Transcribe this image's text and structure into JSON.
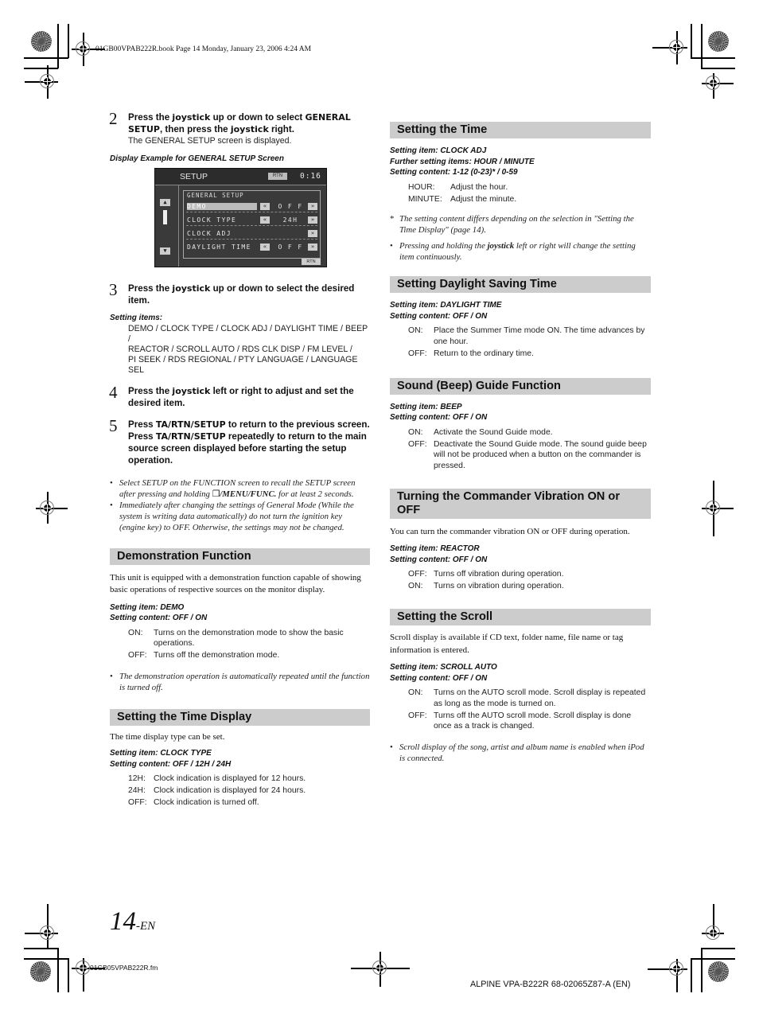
{
  "slug_top": "01GB00VPAB222R.book  Page 14  Monday, January 23, 2006  4:24 AM",
  "slug_bottom": "01GB05VPAB222R.fm",
  "footer": "ALPINE VPA-B222R 68-02065Z87-A (EN)",
  "page_number": {
    "number": "14",
    "suffix": "-EN"
  },
  "left": {
    "step2": {
      "num": "2",
      "text_parts": [
        "Press the ",
        "joystick",
        " up or down to select ",
        "GENERAL SETUP",
        ", then press the ",
        "joystick",
        " right."
      ],
      "sub": "The GENERAL SETUP screen is displayed."
    },
    "display_caption": "Display Example for GENERAL SETUP Screen",
    "screen": {
      "title": "SETUP",
      "rtn_top": "RTN",
      "clock": "0:16",
      "up_icon": "▲",
      "down_icon": "▼",
      "panel_title": "GENERAL SETUP",
      "rows": [
        {
          "label": "DEMO",
          "value": "O F F",
          "left_btn": "«",
          "right_btn": "»",
          "selected": true
        },
        {
          "label": "CLOCK TYPE",
          "value": "24H",
          "left_btn": "«",
          "right_btn": "»",
          "selected": false
        },
        {
          "label": "CLOCK ADJ",
          "value": "",
          "left_btn": "",
          "right_btn": "»",
          "selected": false
        },
        {
          "label": "DAYLIGHT TIME",
          "value": "O F F",
          "left_btn": "«",
          "right_btn": "»",
          "selected": false
        }
      ],
      "rtn_bottom": "RTN"
    },
    "step3": {
      "num": "3",
      "text_parts": [
        "Press the ",
        "joystick",
        " up or down to select the desired item."
      ]
    },
    "setting_items_label": "Setting items:",
    "setting_items_lines": [
      "DEMO / CLOCK TYPE / CLOCK ADJ / DAYLIGHT TIME / BEEP /",
      "REACTOR / SCROLL AUTO / RDS CLK DISP / FM LEVEL /",
      "PI SEEK / RDS REGIONAL / PTY LANGUAGE / LANGUAGE SEL"
    ],
    "step4": {
      "num": "4",
      "text_parts": [
        "Press the ",
        "joystick",
        " left or right to adjust and set the desired item."
      ]
    },
    "step5": {
      "num": "5",
      "text_parts": [
        "Press ",
        "TA/RTN/SETUP",
        " to return to the previous screen. Press ",
        "TA/RTN/SETUP",
        " repeatedly to return to the main source screen displayed before starting the setup operation."
      ]
    },
    "notes": [
      {
        "pre": "Select SETUP on the FUNCTION screen to recall the SETUP screen after pressing and holding ",
        "icon": "❐",
        "bold": "/MENU/FUNC.",
        "post": " for at least 2 seconds."
      },
      {
        "pre": "Immediately after changing the settings of General Mode (While the system is writing data automatically) do not turn the ignition key (engine key) to OFF. Otherwise, the settings may not be changed.",
        "icon": "",
        "bold": "",
        "post": ""
      }
    ],
    "demo": {
      "heading": "Demonstration Function",
      "intro": "This unit is equipped with a demonstration function capable of showing basic operations of respective sources on the monitor display.",
      "item": "Setting item: DEMO",
      "content": "Setting content: OFF / ON",
      "defs": [
        {
          "term": "ON:",
          "desc": "Turns on the demonstration mode to show the basic operations."
        },
        {
          "term": "OFF:",
          "desc": "Turns off the demonstration mode."
        }
      ],
      "note": "The demonstration operation is automatically repeated until the function is turned off."
    },
    "time_display": {
      "heading": "Setting the Time Display",
      "intro": "The time display type can be set.",
      "item": "Setting item: CLOCK TYPE",
      "content": "Setting content: OFF / 12H / 24H",
      "defs": [
        {
          "term": "12H:",
          "desc": "Clock indication is displayed for 12 hours."
        },
        {
          "term": "24H:",
          "desc": "Clock indication is displayed for 24 hours."
        },
        {
          "term": "OFF:",
          "desc": "Clock indication is turned off."
        }
      ]
    }
  },
  "right": {
    "time": {
      "heading": "Setting the Time",
      "item": "Setting item: CLOCK ADJ",
      "further": "Further setting items: HOUR / MINUTE",
      "content": "Setting content: 1-12 (0-23)* / 0-59",
      "defs": [
        {
          "term": "HOUR:",
          "desc": "Adjust the hour."
        },
        {
          "term": "MINUTE:",
          "desc": "Adjust the minute."
        }
      ],
      "footnote": "The setting content differs depending on the selection in \"Setting the Time Display\" (page 14).",
      "footnote_mark": "*",
      "note_pre": "Pressing and holding the ",
      "note_bold": "joystick",
      "note_post": " left or right will change the setting item continuously."
    },
    "daylight": {
      "heading": "Setting Daylight Saving Time",
      "item": "Setting item: DAYLIGHT TIME",
      "content": "Setting content: OFF / ON",
      "defs": [
        {
          "term": "ON:",
          "desc": "Place the Summer Time mode ON. The time advances by one hour."
        },
        {
          "term": "OFF:",
          "desc": "Return to the ordinary time."
        }
      ]
    },
    "beep": {
      "heading": "Sound (Beep) Guide Function",
      "item": "Setting item: BEEP",
      "content": "Setting content: OFF / ON",
      "defs": [
        {
          "term": "ON:",
          "desc": "Activate the Sound Guide mode."
        },
        {
          "term": "OFF:",
          "desc": "Deactivate the Sound Guide mode. The sound guide beep will not be produced when a button on the commander is pressed."
        }
      ]
    },
    "vibration": {
      "heading": "Turning the Commander Vibration ON or OFF",
      "intro": "You can turn the commander vibration ON or OFF during operation.",
      "item": "Setting item: REACTOR",
      "content": "Setting content: OFF / ON",
      "defs": [
        {
          "term": "OFF:",
          "desc": "Turns off vibration during operation."
        },
        {
          "term": "ON:",
          "desc": "Turns on vibration during operation."
        }
      ]
    },
    "scroll": {
      "heading": "Setting the Scroll",
      "intro": "Scroll display is available if CD text, folder name, file name or tag information is entered.",
      "item": "Setting item: SCROLL AUTO",
      "content": "Setting content: OFF / ON",
      "defs": [
        {
          "term": "ON:",
          "desc": "Turns on the AUTO scroll mode. Scroll display is repeated as long as the mode is turned on."
        },
        {
          "term": "OFF:",
          "desc": "Turns off the AUTO scroll mode. Scroll display is done once as a track is changed."
        }
      ],
      "note": "Scroll display of the song, artist and album name is enabled when iPod is connected."
    }
  }
}
